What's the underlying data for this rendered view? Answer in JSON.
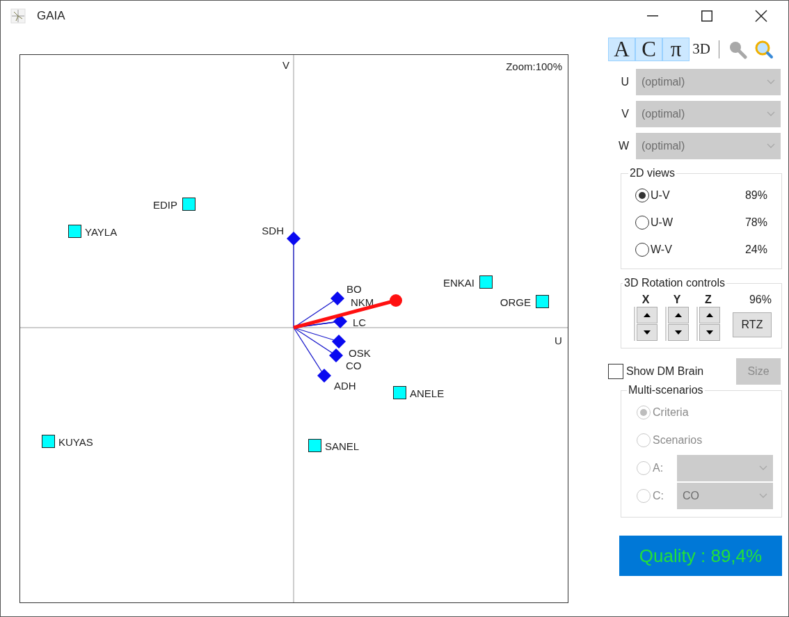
{
  "window": {
    "title": "GAIA"
  },
  "plot": {
    "zoom": "Zoom:100%",
    "v_axis_label": "V",
    "u_axis_label": "U",
    "alternatives": [
      {
        "label": "EDIP"
      },
      {
        "label": "YAYLA"
      },
      {
        "label": "ENKAI"
      },
      {
        "label": "ORGE"
      },
      {
        "label": "ANELE"
      },
      {
        "label": "KUYAS"
      },
      {
        "label": "SANEL"
      }
    ],
    "criteria": [
      {
        "label": "SDH"
      },
      {
        "label": "BO"
      },
      {
        "label": "NKM"
      },
      {
        "label": "LC"
      },
      {
        "label": "OSK"
      },
      {
        "label": "CO"
      },
      {
        "label": "ADH"
      }
    ]
  },
  "toolbar": [
    {
      "label": "A",
      "selected": true
    },
    {
      "label": "C",
      "selected": true
    },
    {
      "label": "π",
      "selected": true
    },
    {
      "label": "3D",
      "selected": false
    }
  ],
  "axes": [
    {
      "label": "U",
      "value": "(optimal)",
      "disabled": true
    },
    {
      "label": "V",
      "value": "(optimal)",
      "disabled": true
    },
    {
      "label": "W",
      "value": "(optimal)",
      "disabled": true
    }
  ],
  "views": {
    "title": "2D views",
    "options": [
      {
        "label": "U-V",
        "percent": "89%",
        "selected": true
      },
      {
        "label": "U-W",
        "percent": "78%",
        "selected": false
      },
      {
        "label": "W-V",
        "percent": "24%",
        "selected": false
      }
    ]
  },
  "rotation": {
    "title": "3D Rotation controls",
    "axes": [
      "X",
      "Y",
      "Z"
    ],
    "percent": "96%",
    "reset": "RTZ"
  },
  "dm_brain": {
    "label": "Show DM Brain",
    "checked": false
  },
  "size_button": {
    "label": "Size",
    "disabled": true
  },
  "multi_scenarios": {
    "title": "Multi-scenarios",
    "options": [
      {
        "kind": "plain",
        "label": "Criteria",
        "selected": true,
        "disabled": true
      },
      {
        "kind": "plain",
        "label": "Scenarios",
        "selected": false,
        "disabled": true
      },
      {
        "kind": "dropdown",
        "label": "A:",
        "selected": false,
        "disabled": true
      },
      {
        "kind": "dropdown",
        "label": "C:",
        "value": "CO",
        "selected": false,
        "disabled": true
      }
    ]
  },
  "quality": "Quality : 89,4%"
}
